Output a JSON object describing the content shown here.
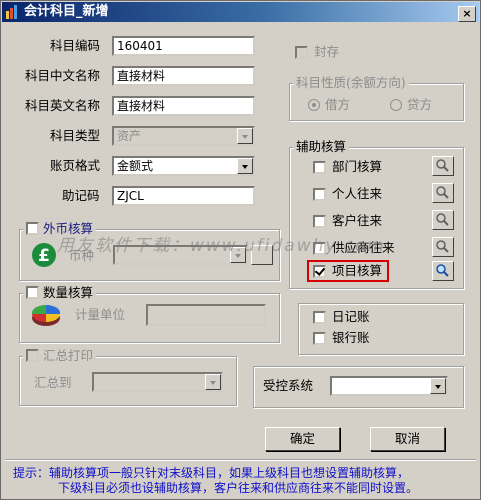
{
  "window": {
    "title": "会计科目_新增",
    "close_label": "×"
  },
  "fields": {
    "code": {
      "label": "科目编码",
      "value": "160401"
    },
    "cn_name": {
      "label": "科目中文名称",
      "value": "直接材料"
    },
    "en_name": {
      "label": "科目英文名称",
      "value": "直接材料"
    },
    "type": {
      "label": "科目类型",
      "value": "资产"
    },
    "ledger_format": {
      "label": "账页格式",
      "value": "金额式"
    },
    "mnemonic": {
      "label": "助记码",
      "value": "ZJCL"
    }
  },
  "sealed": {
    "label": "封存",
    "checked": false
  },
  "nature": {
    "title": "科目性质(余额方向)",
    "debit": "借方",
    "credit": "贷方",
    "selected": "借方"
  },
  "aux": {
    "title": "辅助核算",
    "items": [
      {
        "label": "部门核算",
        "checked": false
      },
      {
        "label": "个人往来",
        "checked": false
      },
      {
        "label": "客户往来",
        "checked": false
      },
      {
        "label": "供应商往来",
        "checked": false
      },
      {
        "label": "项目核算",
        "checked": true
      }
    ]
  },
  "foreign": {
    "label": "外币核算",
    "currency_label": "币种",
    "checked": false
  },
  "quantity": {
    "label": "数量核算",
    "unit_label": "计量单位",
    "checked": false
  },
  "summary_print": {
    "label": "汇总打印",
    "to_label": "汇总到",
    "checked": false
  },
  "books": {
    "journal": "日记账",
    "bank": "银行账"
  },
  "controlled": {
    "label": "受控系统",
    "value": ""
  },
  "buttons": {
    "ok": "确定",
    "cancel": "取消"
  },
  "watermark": "用友软件下载：www.ufidawhy.com",
  "tip": {
    "line1": "提示：辅助核算项一般只针对末级科目，如果上级科目也想设置辅助核算，",
    "line2": "下级科目必须也设辅助核算，客户往来和供应商往来不能同时设置。"
  },
  "colors": {
    "title_bar": "#0a246a",
    "dialog_bg": "#d4d0c8",
    "highlight_box": "#d40000",
    "tip_text": "#1010c8"
  }
}
